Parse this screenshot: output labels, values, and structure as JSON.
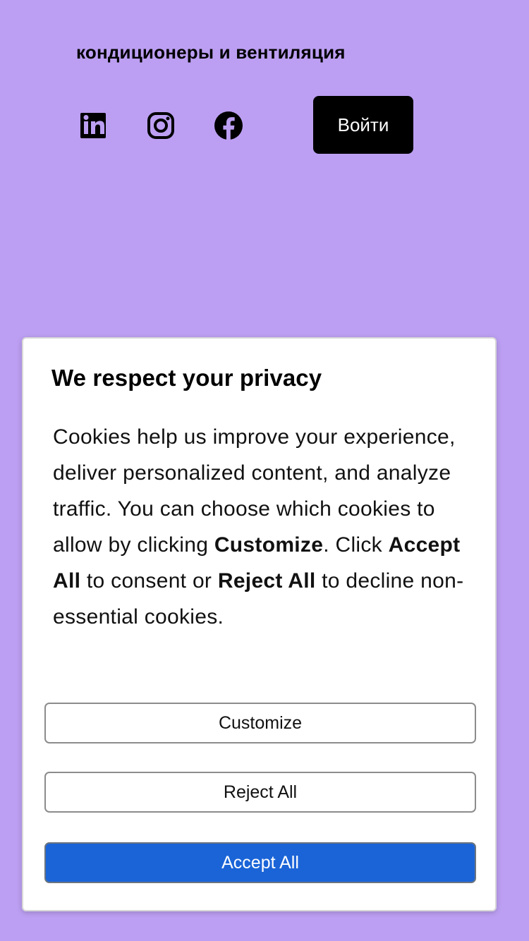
{
  "header": {
    "title": "кондиционеры и вентиляция",
    "login_label": "Войти"
  },
  "social": {
    "icons": [
      "linkedin-icon",
      "instagram-icon",
      "facebook-icon"
    ]
  },
  "privacy": {
    "title": "We respect your privacy",
    "text_intro": "Cookies help us improve your experience, deliver personalized content, and analyze traffic. You can choose which cookies to allow by clicking ",
    "customize_emphasis": "Customize",
    "text_click": ". Click ",
    "accept_emphasis": "Accept All",
    "text_consent": " to consent or ",
    "reject_emphasis": "Reject All",
    "text_end": " to decline non-essential cookies.",
    "buttons": {
      "customize": "Customize",
      "reject": "Reject All",
      "accept": "Accept All"
    }
  },
  "colors": {
    "page_background": "#bc9ff2",
    "primary_button": "#1a64d8",
    "login_button": "#000000",
    "modal_background": "#ffffff"
  }
}
